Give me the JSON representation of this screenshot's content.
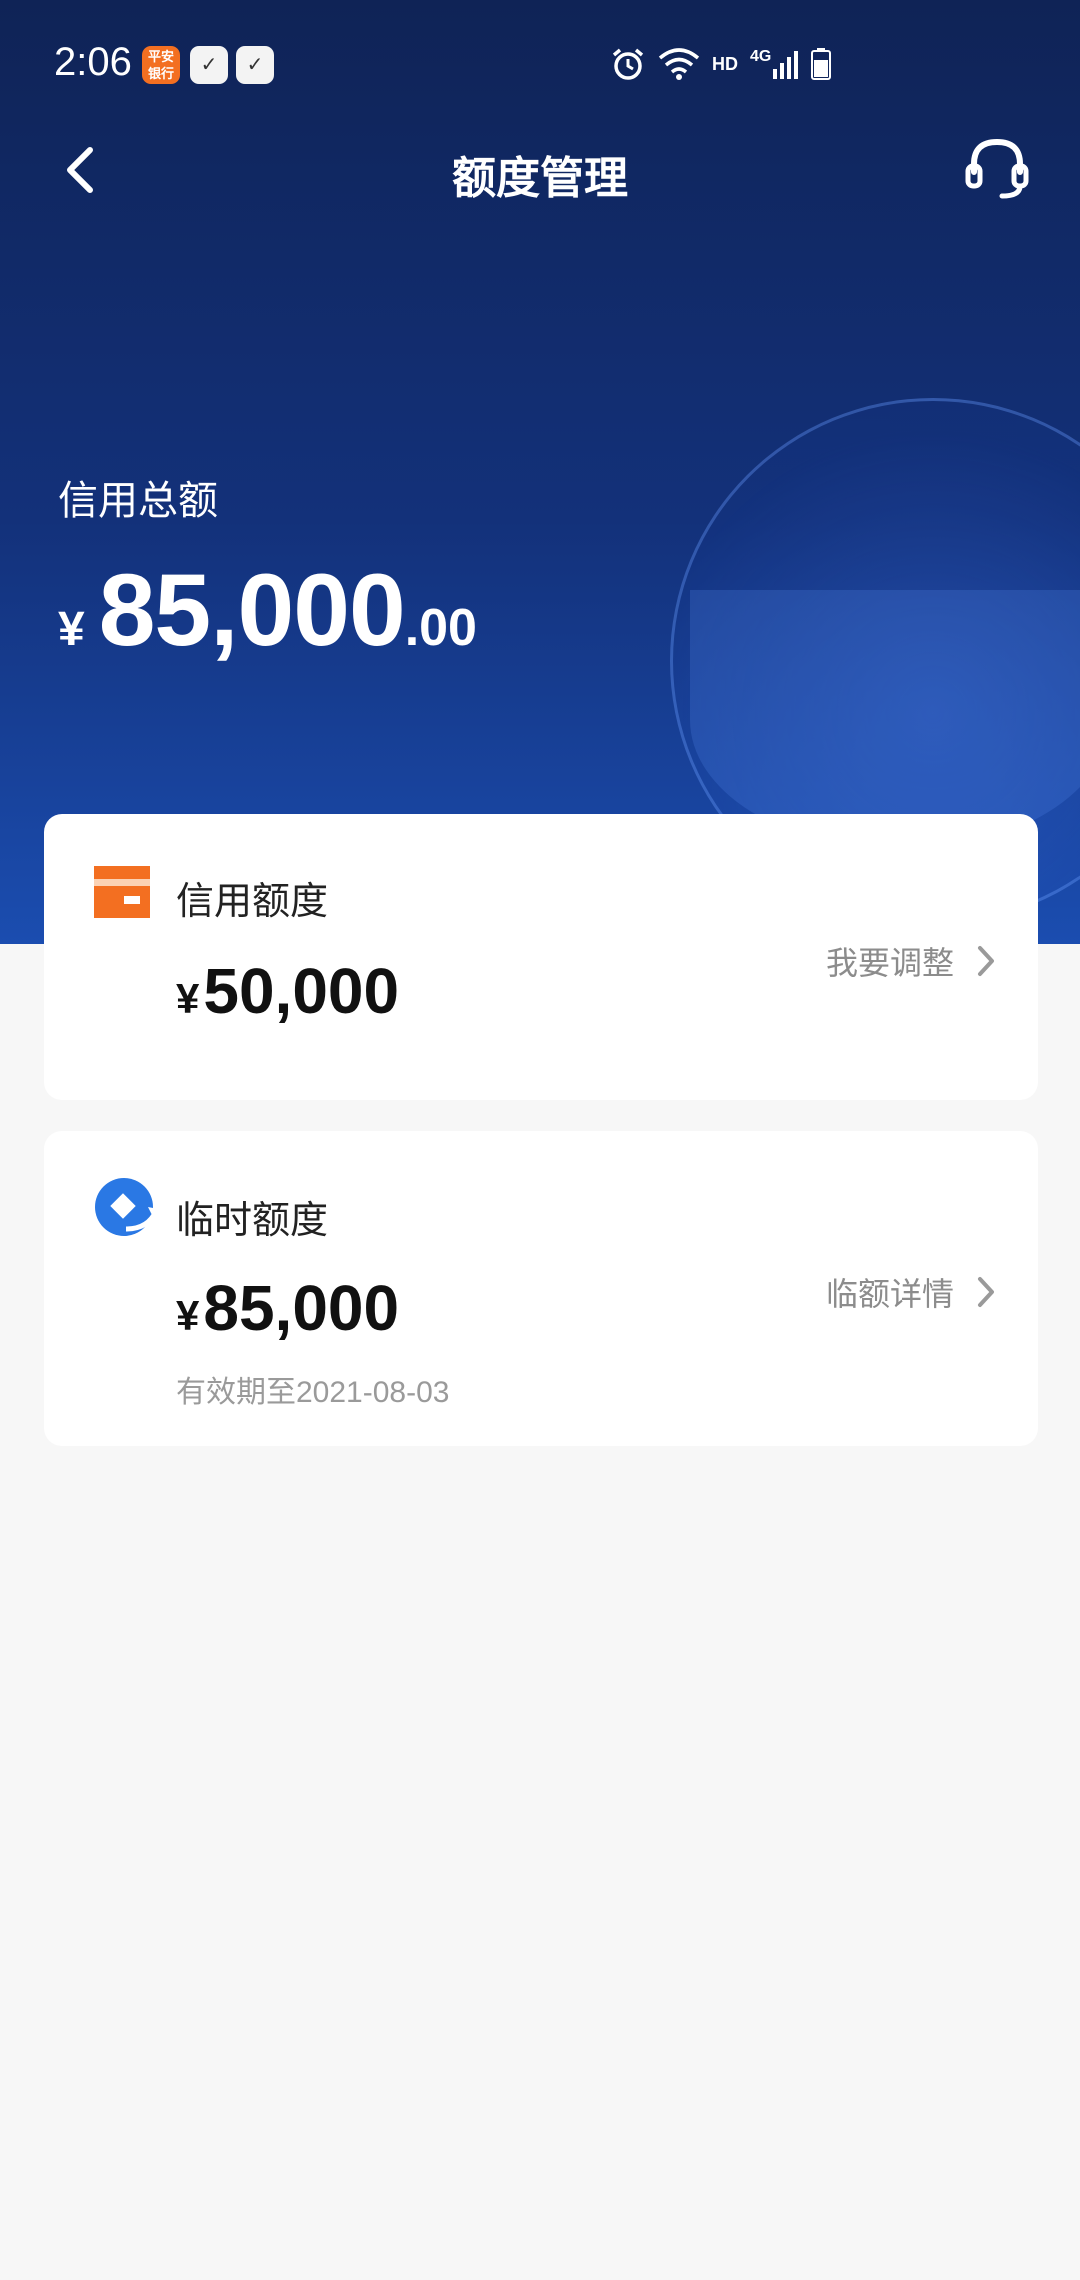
{
  "status_bar": {
    "time": "2:06",
    "app_badge": "平安银行",
    "network": "4G",
    "hd": "HD"
  },
  "header": {
    "title": "额度管理"
  },
  "summary": {
    "label": "信用总额",
    "currency": "¥",
    "amount_int": "85,000",
    "amount_dec": ".00"
  },
  "credit_card": {
    "title": "信用额度",
    "currency": "¥",
    "amount": "50,000",
    "action": "我要调整"
  },
  "temp_card": {
    "title": "临时额度",
    "currency": "¥",
    "amount": "85,000",
    "valid_until": "有效期至2021-08-03",
    "action": "临额详情"
  },
  "colors": {
    "hero_top": "#0f2356",
    "hero_bottom": "#1b4db0",
    "credit_icon": "#f36f21",
    "temp_icon": "#2a78e4"
  }
}
